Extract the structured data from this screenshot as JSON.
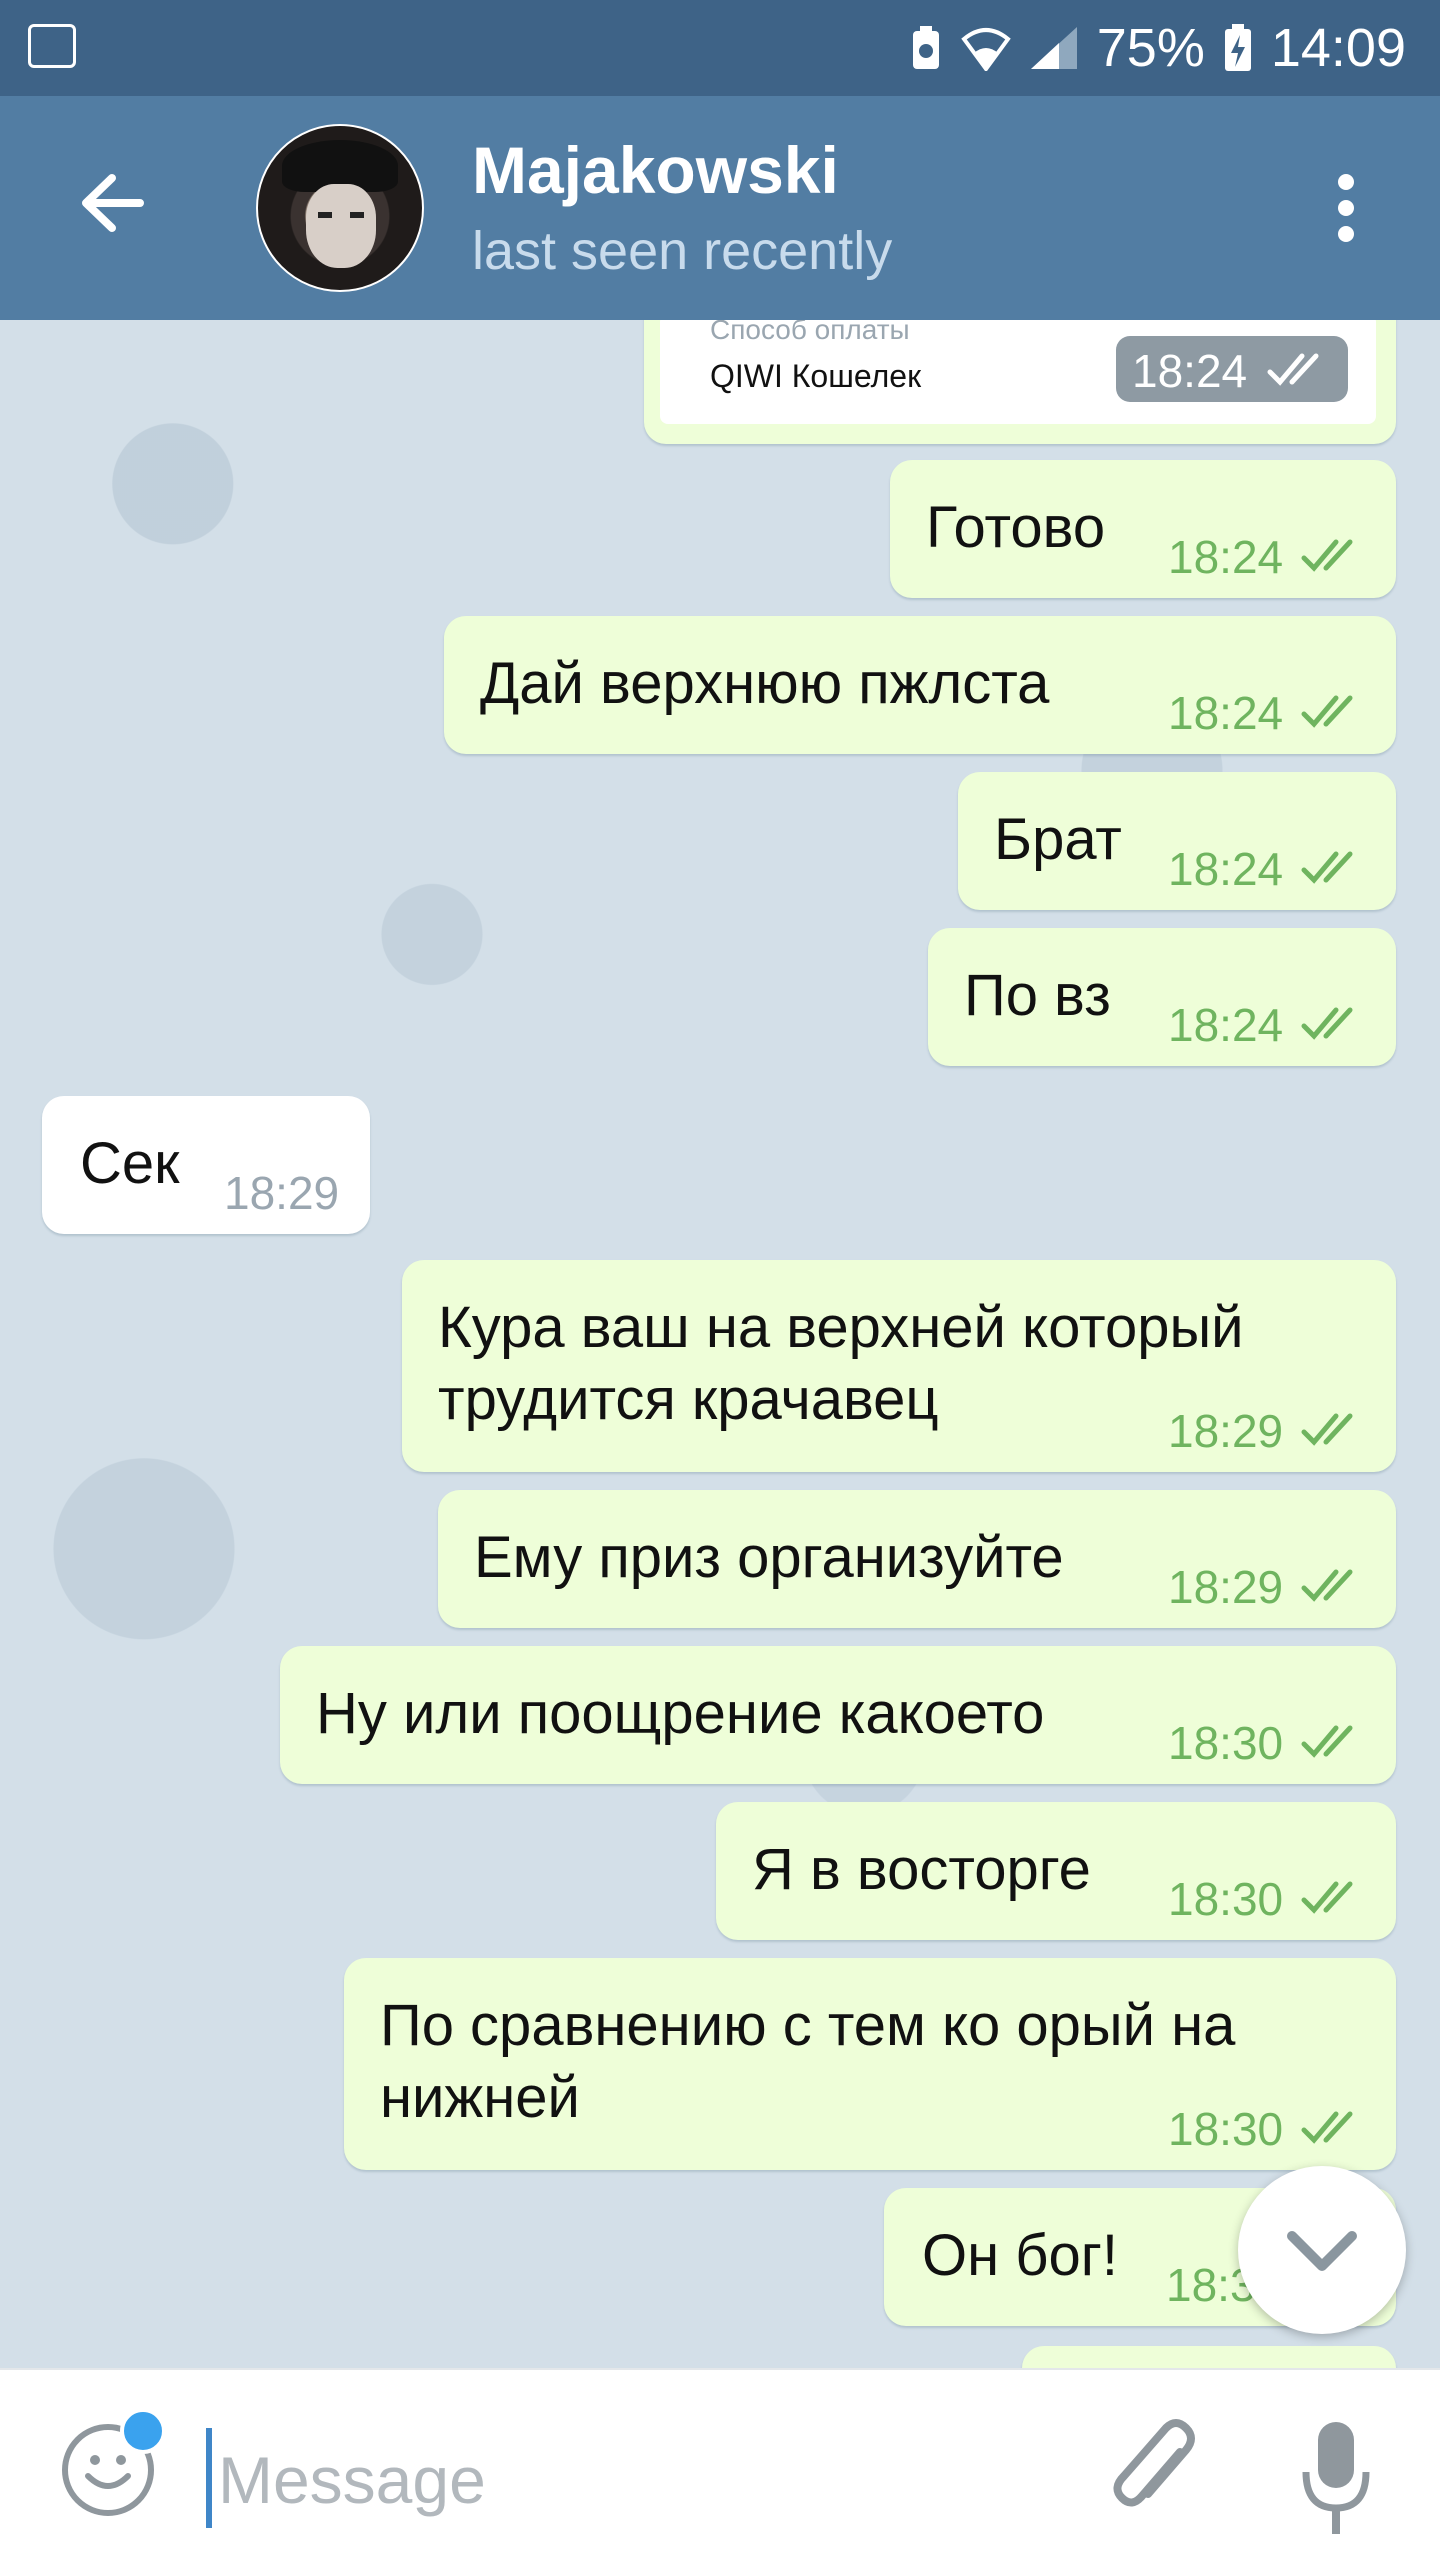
{
  "status_bar": {
    "battery": "75%",
    "time": "14:09"
  },
  "header": {
    "title": "Majakowski",
    "subtitle": "last seen recently"
  },
  "payment_card": {
    "label": "Способ оплаты",
    "value": "QIWI Кошелек",
    "time": "18:24"
  },
  "messages": [
    {
      "text": "Готово",
      "time": "18:24",
      "dir": "out"
    },
    {
      "text": "Дай верхнюю пжлста",
      "time": "18:24",
      "dir": "out"
    },
    {
      "text": "Брат",
      "time": "18:24",
      "dir": "out"
    },
    {
      "text": "По вз",
      "time": "18:24",
      "dir": "out"
    },
    {
      "text": "Сек",
      "time": "18:29",
      "dir": "in"
    },
    {
      "text": "Кура ваш на верхней который трудится крачавец",
      "time": "18:29",
      "dir": "out"
    },
    {
      "text": "Ему приз организуйте",
      "time": "18:29",
      "dir": "out"
    },
    {
      "text": "Ну или поощрение какоето",
      "time": "18:30",
      "dir": "out"
    },
    {
      "text": "Я в восторге",
      "time": "18:30",
      "dir": "out"
    },
    {
      "text": "По сравнению с тем ко орый на нижней",
      "time": "18:30",
      "dir": "out"
    },
    {
      "text": "Он бог!",
      "time": "18:3",
      "dir": "out"
    }
  ],
  "input": {
    "placeholder": "Message"
  },
  "colors": {
    "header": "#527da3",
    "statusbar": "#3e6387",
    "outgoing_bubble": "#eefed8",
    "tick_green": "#6fb45f",
    "accent_dot": "#3aa2ee"
  },
  "icons": [
    "gallery-icon",
    "battery-saver-icon",
    "wifi-icon",
    "signal-icon",
    "battery-charging-icon",
    "back-arrow-icon",
    "more-vert-icon",
    "double-check-icon",
    "chevron-down-icon",
    "emoji-icon",
    "paperclip-icon",
    "microphone-icon"
  ]
}
